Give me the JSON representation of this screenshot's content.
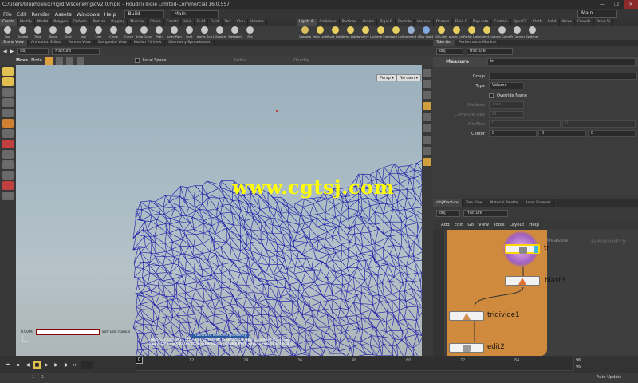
{
  "window": {
    "title": "C:/Users/bluphoenix/Rigid/V/scene/rigidV2.0.hiplc - Houdini Indie Limited-Commercial 16.0.557",
    "controls": [
      "—",
      "❐",
      "✕"
    ]
  },
  "menu": {
    "items": [
      "File",
      "Edit",
      "Render",
      "Assets",
      "Windows",
      "Help"
    ],
    "build_desktop": "Build",
    "main_desktop": "Main",
    "right_desktop": "Main"
  },
  "shelf_tabs_left": [
    "Create",
    "Modify",
    "Model",
    "Polygon",
    "Deform",
    "Texture",
    "Rigging",
    "Muscles",
    "Chara",
    "Constr",
    "Hair",
    "Guid",
    "Guid",
    "Terr",
    "Clou",
    "Volume"
  ],
  "shelf_tabs_right": [
    "Lights &",
    "Collisions",
    "Particles",
    "Grains",
    "Rigid B",
    "Particle",
    "Viscous",
    "Oceans",
    "Fluid C",
    "Populate",
    "Contain",
    "Pyro FX",
    "Cloth",
    "Solid",
    "Wires",
    "Crowds",
    "Drive Si"
  ],
  "shelf_tools_left": [
    {
      "label": "Box",
      "color": "#c8c8c8"
    },
    {
      "label": "Sphere",
      "color": "#c8c8c8"
    },
    {
      "label": "Tube",
      "color": "#c8c8c8"
    },
    {
      "label": "Torus",
      "color": "#c8c8c8"
    },
    {
      "label": "Grid",
      "color": "#c8c8c8"
    },
    {
      "label": "Null",
      "color": "#c8c8c8"
    },
    {
      "label": "Line",
      "color": "#c8c8c8"
    },
    {
      "label": "Circle",
      "color": "#c8c8c8"
    },
    {
      "label": "Curve",
      "color": "#c8c8c8"
    },
    {
      "label": "Draw Curve",
      "color": "#c8c8c8"
    },
    {
      "label": "Path",
      "color": "#c8c8c8"
    },
    {
      "label": "Spray Paint",
      "color": "#c8c8c8"
    },
    {
      "label": "Font",
      "color": "#c8c8c8"
    },
    {
      "label": "Platonic Solids",
      "color": "#c8c8c8"
    },
    {
      "label": "L-System",
      "color": "#c8c8c8"
    },
    {
      "label": "Metaball",
      "color": "#c8c8c8"
    },
    {
      "label": "File",
      "color": "#c8c8c8"
    }
  ],
  "shelf_tools_right": [
    {
      "label": "Camera",
      "color": "#d8c060"
    },
    {
      "label": "Point Light",
      "color": "#e8d060"
    },
    {
      "label": "Spot Light",
      "color": "#e8d060"
    },
    {
      "label": "Area Light",
      "color": "#e8d060"
    },
    {
      "label": "Geometry Light",
      "color": "#e8d060"
    },
    {
      "label": "Volume Light",
      "color": "#e8d060"
    },
    {
      "label": "Distant Light",
      "color": "#e8d060"
    },
    {
      "label": "Environment Light",
      "color": "#9ab0d0"
    },
    {
      "label": "Sky Light",
      "color": "#80a8e0"
    },
    {
      "label": "GI Light",
      "color": "#e8d060"
    },
    {
      "label": "Caustic Light",
      "color": "#e8d060"
    },
    {
      "label": "Portal Light",
      "color": "#e8d060"
    },
    {
      "label": "Ambient Light",
      "color": "#e8d060"
    },
    {
      "label": "Stereo Camera",
      "color": "#c8c8c8"
    },
    {
      "label": "VR Camera",
      "color": "#c8c8c8"
    },
    {
      "label": "Switcher",
      "color": "#c8c8c8"
    }
  ],
  "left_tabs": [
    "Scene View",
    "Animation Editor",
    "Render View",
    "Composite View",
    "Motion FX View",
    "Geometry Spreadsheet"
  ],
  "left_path": {
    "back": "◀",
    "fwd": "▶",
    "obj": "obj",
    "node": "fracture"
  },
  "vp_toolbar": {
    "mode": "Move",
    "mode2": "Mode",
    "local_space": "Local Space",
    "radius": "Radius",
    "opacity": "Opacity"
  },
  "viewport": {
    "persp": "Persp ▾",
    "nocam": "No cam ▾",
    "watermark": "www.cgtsj.com",
    "hint_title": "Transform selected geometry",
    "hint_lines": [
      "Hold A or Ctrl+A or Ctrl+A or Ctrl+Shift to select full loop, cylinder | Mbl (drag)",
      "Double-LMB click to select an edge loop or double-MMB click to ring select edges"
    ],
    "soft_value": "0.0000",
    "soft_label": "Soft Edit Radius"
  },
  "right_tabs": [
    "Take List",
    "Performance Monitor"
  ],
  "right_path": {
    "obj": "obj",
    "node": "fracture"
  },
  "params": {
    "node_type": "Measure",
    "node_name": "tr",
    "group_label": "Group",
    "type_label": "Type",
    "type_value": "Volume",
    "override_label": "Override Name",
    "attribute_label": "Attribute",
    "attribute_value": "area",
    "curvature_label": "Curvature Type",
    "curvature_value": "GI",
    "minmax_label": "Min/Max",
    "center_label": "Center",
    "center_values": [
      "0",
      "0",
      "0"
    ],
    "minmax_values": [
      "0",
      "0"
    ]
  },
  "net_tabs": [
    "/obj/fracture",
    "Tree View",
    "Material Palette",
    "Asset Browser"
  ],
  "net_path": {
    "obj": "obj",
    "node": "fracture"
  },
  "net_menu": [
    "Add",
    "Edit",
    "Go",
    "View",
    "Tools",
    "Layout",
    "Help"
  ],
  "network": {
    "context": "Geometry",
    "measure_type": "Measure",
    "nodes": [
      {
        "name": "tr"
      },
      {
        "name": "blast3"
      },
      {
        "name": "tridivide1"
      },
      {
        "name": "edit2"
      }
    ]
  },
  "timeline": {
    "frame": "0",
    "ticks": [
      "12",
      "24",
      "36",
      "48",
      "60",
      "72",
      "84"
    ],
    "end1": "96",
    "end2": "96",
    "start1": "1",
    "start2": "1",
    "auto_update": "Auto Update"
  }
}
